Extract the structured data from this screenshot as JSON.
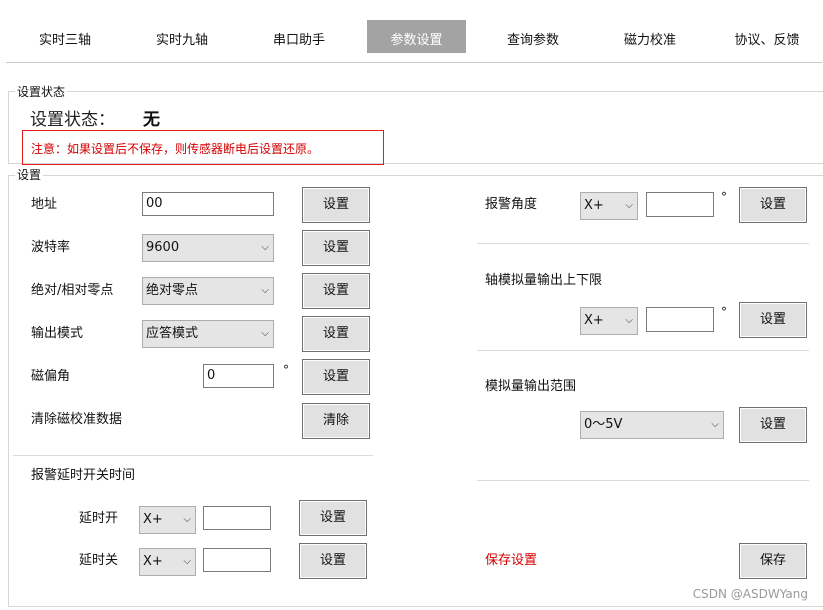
{
  "tabs": [
    {
      "label": "实时三轴"
    },
    {
      "label": "实时九轴"
    },
    {
      "label": "串口助手"
    },
    {
      "label": "参数设置"
    },
    {
      "label": "查询参数"
    },
    {
      "label": "磁力校准"
    },
    {
      "label": "协议、反馈"
    }
  ],
  "status_group": {
    "legend": "设置状态",
    "status_label": "设置状态：",
    "status_value": "无",
    "warning": "注意：如果设置后不保存，则传感器断电后设置还原。"
  },
  "settings_group": {
    "legend": "设置",
    "address": {
      "label": "地址",
      "value": "00",
      "button": "设置"
    },
    "baud": {
      "label": "波特率",
      "value": "9600",
      "button": "设置"
    },
    "zero": {
      "label": "绝对/相对零点",
      "value": "绝对零点",
      "button": "设置"
    },
    "output_mode": {
      "label": "输出模式",
      "value": "应答模式",
      "button": "设置"
    },
    "declination": {
      "label": "磁偏角",
      "value": "0",
      "unit": "°",
      "button": "设置"
    },
    "clear_cal": {
      "label": "清除磁校准数据",
      "button": "清除"
    },
    "alarm_delay": {
      "title": "报警延时开关时间",
      "on": {
        "label": "延时开",
        "axis": "X+",
        "value": "",
        "button": "设置"
      },
      "off": {
        "label": "延时关",
        "axis": "X+",
        "value": "",
        "button": "设置"
      }
    },
    "alarm_angle": {
      "label": "报警角度",
      "axis": "X+",
      "value": "",
      "unit": "°",
      "button": "设置"
    },
    "analog_limits": {
      "label": "轴模拟量输出上下限",
      "axis": "X+",
      "value": "",
      "unit": "°",
      "button": "设置"
    },
    "analog_range": {
      "label": "模拟量输出范围",
      "value": "0～5V",
      "button": "设置"
    },
    "save": {
      "label": "保存设置",
      "button": "保存"
    }
  },
  "watermark": "CSDN @ASDWYang",
  "colors": {
    "active_tab": "#a3a3a3",
    "warning": "#d40000"
  }
}
